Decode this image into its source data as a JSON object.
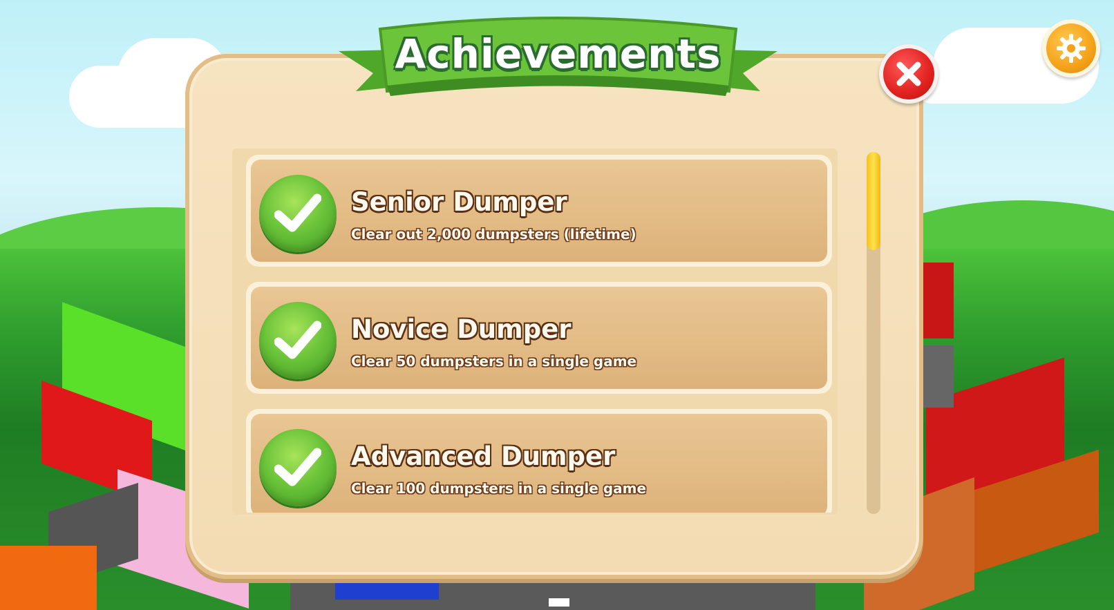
{
  "title": "Achievements",
  "achievements": [
    {
      "name": "Senior Dumper",
      "description": "Clear out 2,000 dumpsters (lifetime)",
      "completed": true
    },
    {
      "name": "Novice Dumper",
      "description": "Clear 50 dumpsters in a single game",
      "completed": true
    },
    {
      "name": "Advanced Dumper",
      "description": "Clear 100 dumpsters in a single game",
      "completed": true
    }
  ],
  "buttons": {
    "close": "close-icon",
    "settings": "gear-icon"
  },
  "colors": {
    "ribbon": "#6cc43a",
    "panel": "#f3dcb3",
    "check": "#6cc43a",
    "close": "#e0211f",
    "settings": "#f5a21a",
    "scroll_thumb": "#ffd42a"
  },
  "scroll": {
    "position_fraction": 0.0,
    "visible_fraction": 0.27
  }
}
